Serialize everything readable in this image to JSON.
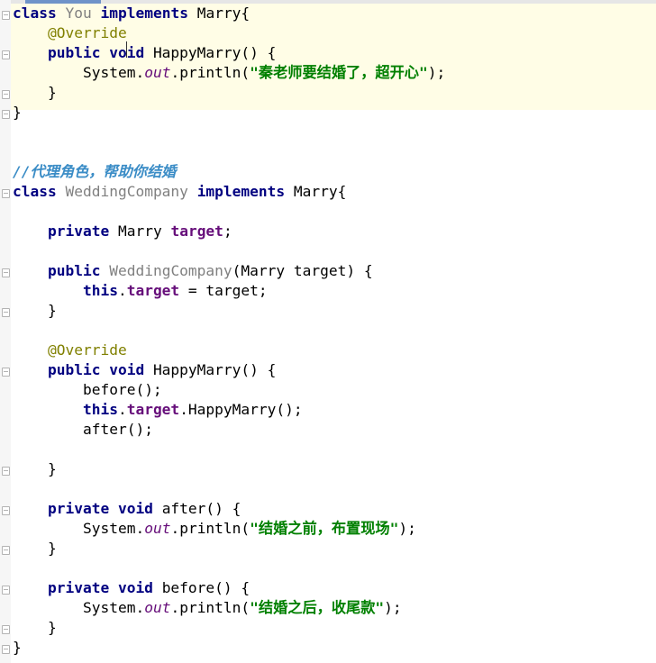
{
  "code": {
    "l1": {
      "kw": "class",
      "name": "You",
      "kw2": "implements",
      "tail": "Marry{"
    },
    "l2": {
      "ann": "@Override"
    },
    "l3": {
      "kw": "public void",
      "tail": "HappyMarry() {"
    },
    "l4": {
      "a": "System.",
      "b": "out",
      "c": ".println(",
      "str": "\"秦老师要结婚了，超开心\"",
      "d": ");"
    },
    "l5": {
      "t": "}"
    },
    "l6": {
      "t": "}"
    },
    "l7": {
      "cmt": "//代理角色，帮助你结婚"
    },
    "l8": {
      "kw": "class",
      "name": "WeddingCompany",
      "kw2": "implements",
      "tail": "Marry{"
    },
    "l9": {
      "kw": "private",
      "type": "Marry",
      "field": "target",
      "tail": ";"
    },
    "l10": {
      "kw": "public",
      "name": "WeddingCompany",
      "tail": "(Marry target) {"
    },
    "l11": {
      "kw": "this",
      "dot": ".",
      "field": "target",
      "tail": " = target;"
    },
    "l12": {
      "t": "}"
    },
    "l13": {
      "ann": "@Override"
    },
    "l14": {
      "kw": "public void",
      "tail": "HappyMarry() {"
    },
    "l15": {
      "t": "before();"
    },
    "l16": {
      "kw": "this",
      "dot": ".",
      "field": "target",
      "tail": ".HappyMarry();"
    },
    "l17": {
      "t": "after();"
    },
    "l18": {
      "t": "}"
    },
    "l19": {
      "kw": "private void",
      "tail": "after() {"
    },
    "l20": {
      "a": "System.",
      "b": "out",
      "c": ".println(",
      "str": "\"结婚之前，布置现场\"",
      "d": ");"
    },
    "l21": {
      "t": "}"
    },
    "l22": {
      "kw": "private void",
      "tail": "before() {"
    },
    "l23": {
      "a": "System.",
      "b": "out",
      "c": ".println(",
      "str": "\"结婚之后，收尾款\"",
      "d": ");"
    },
    "l24": {
      "t": "}"
    },
    "l25": {
      "t": "}"
    }
  }
}
